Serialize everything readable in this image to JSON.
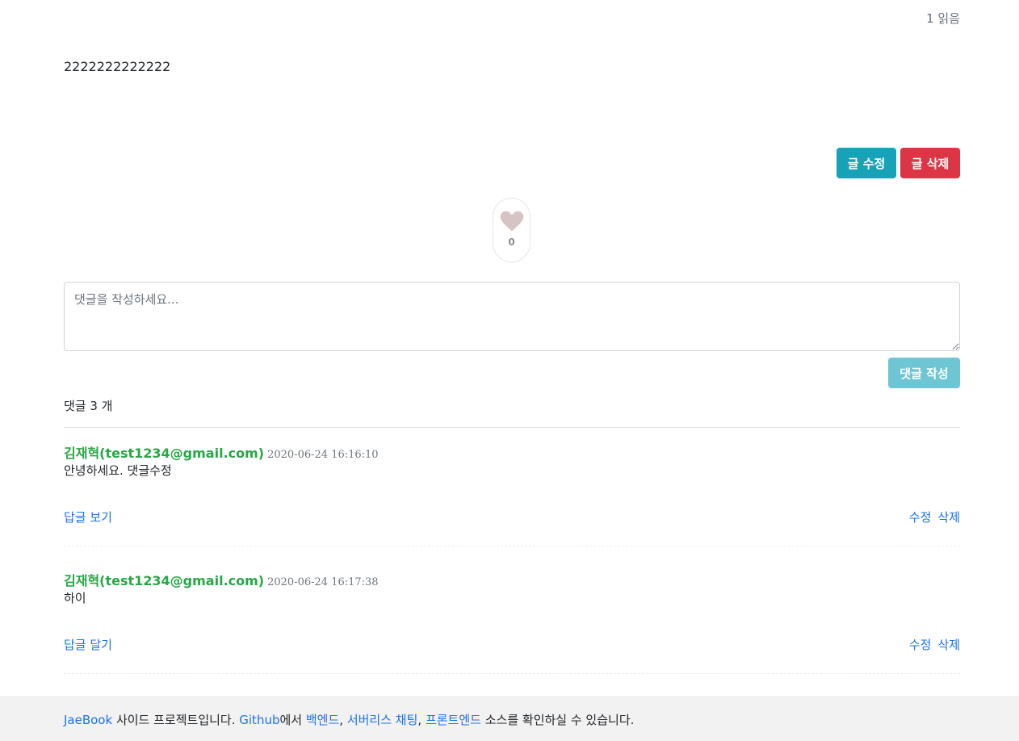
{
  "post": {
    "views": "1 읽음",
    "body": "2222222222222",
    "edit_label": "글 수정",
    "delete_label": "글 삭제"
  },
  "like": {
    "count": "0",
    "icon": "heart-icon",
    "color": "#d6c4c4"
  },
  "comment_form": {
    "placeholder": "댓글을 작성하세요...",
    "submit_label": "댓글 작성"
  },
  "comments": {
    "count_label": "댓글 3 개",
    "items": [
      {
        "author": "김재혁(test1234@gmail.com)",
        "date": "2020-06-24 16:16:10",
        "text": "안녕하세요. 댓글수정",
        "reply_label": "답글 보기",
        "edit_label": "수정",
        "delete_label": "삭제"
      },
      {
        "author": "김재혁(test1234@gmail.com)",
        "date": "2020-06-24 16:17:38",
        "text": "하이",
        "reply_label": "답글 달기",
        "edit_label": "수정",
        "delete_label": "삭제"
      }
    ]
  },
  "footer": {
    "brand": "JaeBook",
    "text1": " 사이드 프로젝트입니다. ",
    "github": "Github",
    "text2": "에서 ",
    "backend": "백엔드",
    "comma1": ", ",
    "chat": "서버리스 채팅",
    "comma2": ", ",
    "frontend": "프론트엔드",
    "text3": " 소스를 확인하실 수 있습니다."
  },
  "colors": {
    "accent_link": "#1a73e8",
    "author": "#28a745",
    "edit_button": "#17a2b8",
    "delete_button": "#dc3545"
  }
}
